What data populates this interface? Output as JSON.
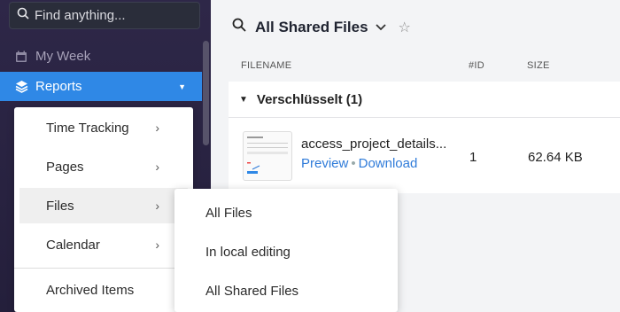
{
  "sidebar": {
    "search_placeholder": "Find anything...",
    "items": [
      {
        "label": "My Week",
        "icon": "calendar-icon"
      },
      {
        "label": "Reports",
        "icon": "layers-icon",
        "active": true
      }
    ]
  },
  "menu": {
    "items": [
      {
        "label": "Time Tracking",
        "has_submenu": true
      },
      {
        "label": "Pages",
        "has_submenu": true
      },
      {
        "label": "Files",
        "has_submenu": true,
        "highlighted": true
      },
      {
        "label": "Calendar",
        "has_submenu": true
      },
      {
        "label": "Archived Items",
        "has_submenu": false
      }
    ]
  },
  "submenu": {
    "items": [
      {
        "label": "All Files"
      },
      {
        "label": "In local editing"
      },
      {
        "label": "All Shared Files"
      }
    ]
  },
  "main": {
    "title": "All Shared Files",
    "columns": {
      "filename": "FILENAME",
      "id": "#ID",
      "size": "SIZE"
    },
    "group": {
      "label": "Verschlüsselt (1)"
    },
    "file": {
      "name": "access_project_details...",
      "preview": "Preview",
      "separator": "•",
      "download": "Download",
      "id": "1",
      "size": "62.64 KB"
    }
  },
  "colors": {
    "accent": "#2f88e6",
    "link": "#2f7bd9",
    "sidebar_bg": "#2e2748"
  }
}
